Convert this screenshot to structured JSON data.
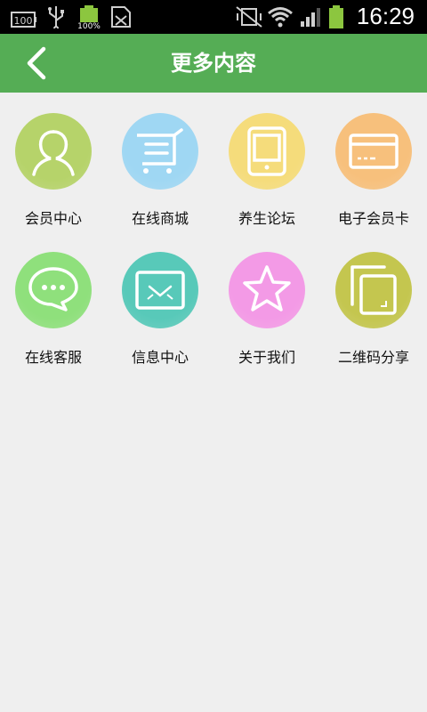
{
  "status_bar": {
    "time": "16:29",
    "battery_small_text": "100%",
    "left_box_text": "100"
  },
  "header": {
    "title": "更多内容"
  },
  "grid": {
    "items": [
      {
        "label": "会员中心",
        "icon": "member-icon",
        "color": "#b6d36a"
      },
      {
        "label": "在线商城",
        "icon": "cart-icon",
        "color": "#9fd7f3"
      },
      {
        "label": "养生论坛",
        "icon": "tablet-icon",
        "color": "#f5dc7b"
      },
      {
        "label": "电子会员卡",
        "icon": "card-icon",
        "color": "#f7c07c"
      },
      {
        "label": "在线客服",
        "icon": "chat-icon",
        "color": "#8fe07c"
      },
      {
        "label": "信息中心",
        "icon": "mail-icon",
        "color": "#58c9b9"
      },
      {
        "label": "关于我们",
        "icon": "star-icon",
        "color": "#f39ae6"
      },
      {
        "label": "二维码分享",
        "icon": "copy-icon",
        "color": "#c4c64f"
      }
    ]
  }
}
